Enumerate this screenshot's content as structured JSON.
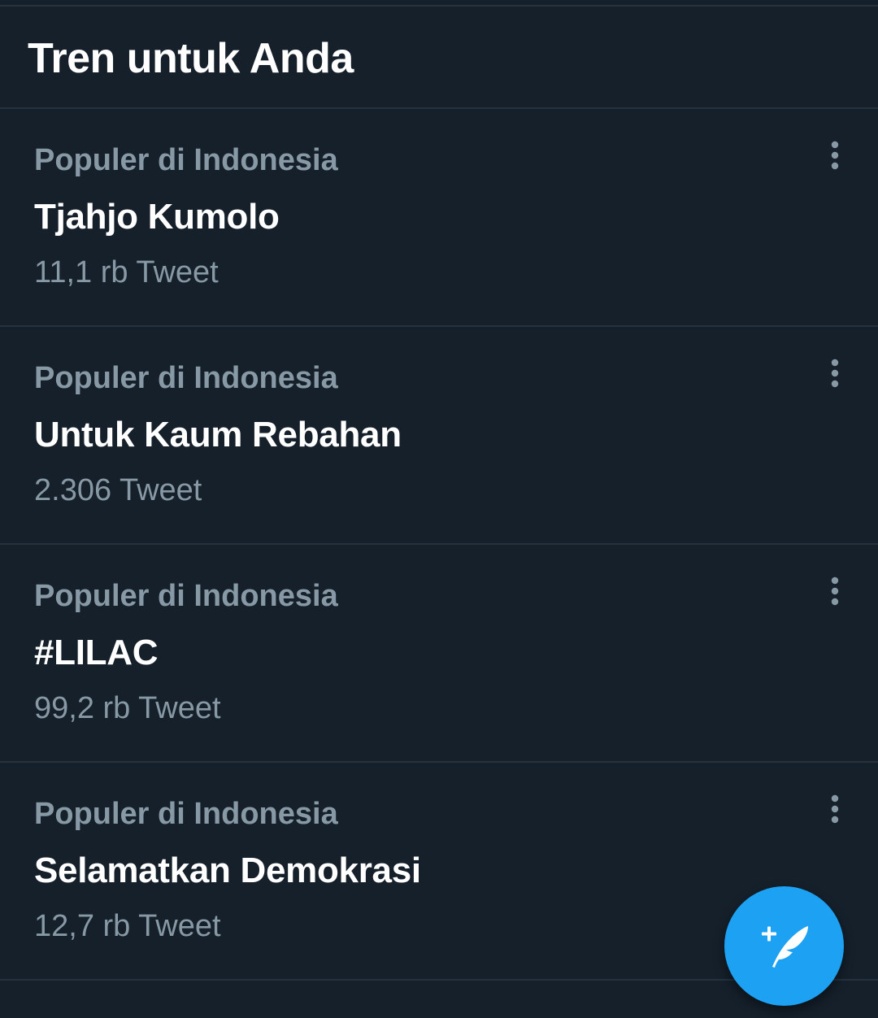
{
  "header": {
    "title": "Tren untuk Anda"
  },
  "trends": [
    {
      "context": "Populer di Indonesia",
      "name": "Tjahjo Kumolo",
      "count": "11,1 rb Tweet"
    },
    {
      "context": "Populer di Indonesia",
      "name": "Untuk Kaum Rebahan",
      "count": "2.306 Tweet"
    },
    {
      "context": "Populer di Indonesia",
      "name": "#LILAC",
      "count": "99,2 rb Tweet"
    },
    {
      "context": "Populer di Indonesia",
      "name": "Selamatkan Demokrasi",
      "count": "12,7 rb Tweet"
    }
  ],
  "icons": {
    "more": "more-vertical-icon",
    "compose": "compose-tweet-icon"
  },
  "colors": {
    "background": "#15202b",
    "divider": "#253341",
    "secondary_text": "#8899a6",
    "primary_text": "#ffffff",
    "accent": "#1da1f2"
  }
}
